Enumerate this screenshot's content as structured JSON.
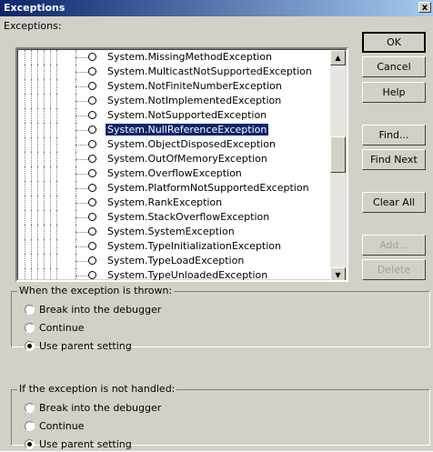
{
  "window": {
    "title": "Exceptions",
    "close_glyph": "x"
  },
  "list": {
    "label": "Exceptions:",
    "items": [
      {
        "text": "System.MissingMethodException",
        "selected": false
      },
      {
        "text": "System.MulticastNotSupportedException",
        "selected": false
      },
      {
        "text": "System.NotFiniteNumberException",
        "selected": false
      },
      {
        "text": "System.NotImplementedException",
        "selected": false
      },
      {
        "text": "System.NotSupportedException",
        "selected": false
      },
      {
        "text": "System.NullReferenceException",
        "selected": true
      },
      {
        "text": "System.ObjectDisposedException",
        "selected": false
      },
      {
        "text": "System.OutOfMemoryException",
        "selected": false
      },
      {
        "text": "System.OverflowException",
        "selected": false
      },
      {
        "text": "System.PlatformNotSupportedException",
        "selected": false
      },
      {
        "text": "System.RankException",
        "selected": false
      },
      {
        "text": "System.StackOverflowException",
        "selected": false
      },
      {
        "text": "System.SystemException",
        "selected": false
      },
      {
        "text": "System.TypeInitializationException",
        "selected": false
      },
      {
        "text": "System.TypeLoadException",
        "selected": false
      },
      {
        "text": "System.TypeUnloadedException",
        "selected": false
      }
    ],
    "scroll_up_glyph": "▲",
    "scroll_down_glyph": "▼"
  },
  "buttons": {
    "ok": "OK",
    "cancel": "Cancel",
    "help": "Help",
    "find": "Find...",
    "find_next": "Find Next",
    "clear_all": "Clear All",
    "add": "Add...",
    "delete": "Delete"
  },
  "thrown_group": {
    "label": "When the exception is thrown:",
    "options": [
      "Break into the debugger",
      "Continue",
      "Use parent setting"
    ],
    "selected_index": 2
  },
  "unhandled_group": {
    "label": "If the exception is not handled:",
    "options": [
      "Break into the debugger",
      "Continue",
      "Use parent setting"
    ],
    "selected_index": 2
  },
  "colors": {
    "selection": "#0a246a",
    "face": "#d4d0c8"
  }
}
